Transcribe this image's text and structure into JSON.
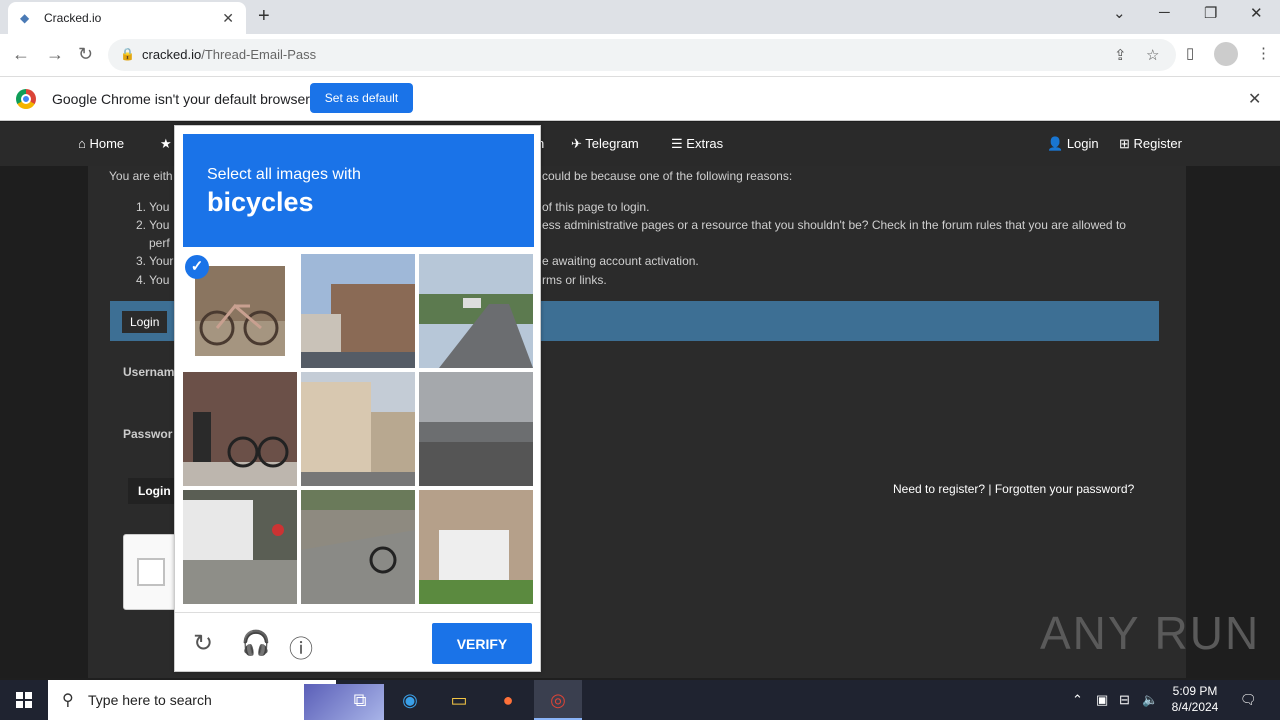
{
  "browser": {
    "tab_title": "Cracked.io",
    "url_domain": "cracked.io",
    "url_path": "/Thread-Email-Pass"
  },
  "infobar": {
    "message": "Google Chrome isn't your default browser",
    "button": "Set as default"
  },
  "sitenav": {
    "home": "Home",
    "telegram": "Telegram",
    "extras": "Extras",
    "login": "Login",
    "register": "Register",
    "partial": "n"
  },
  "content": {
    "intro_left": "You are eith",
    "intro_right": "could be because one of the following reasons:",
    "r1_left": "1. You",
    "r1_right": "of this page to login.",
    "r2_left": "2. You",
    "r2_right": "ess administrative pages or a resource that you shouldn't be? Check in the forum rules that you are allowed to",
    "r2_cont": "perf",
    "r3_left": "3. Your",
    "r3_right": "e awaiting account activation.",
    "r4_left": "4. You",
    "r4_right": "rms or links.",
    "login_tab": "Login",
    "username_label": "Usernam",
    "password_label": "Passwor",
    "login_button": "Login",
    "links": "Need to register? | Forgotten your password?"
  },
  "captcha": {
    "prompt": "Select all images with",
    "target": "bicycles",
    "verify": "VERIFY",
    "accent": "#1a73e8"
  },
  "watermark": "ANY RUN",
  "taskbar": {
    "search_placeholder": "Type here to search",
    "time": "5:09 PM",
    "date": "8/4/2024"
  }
}
